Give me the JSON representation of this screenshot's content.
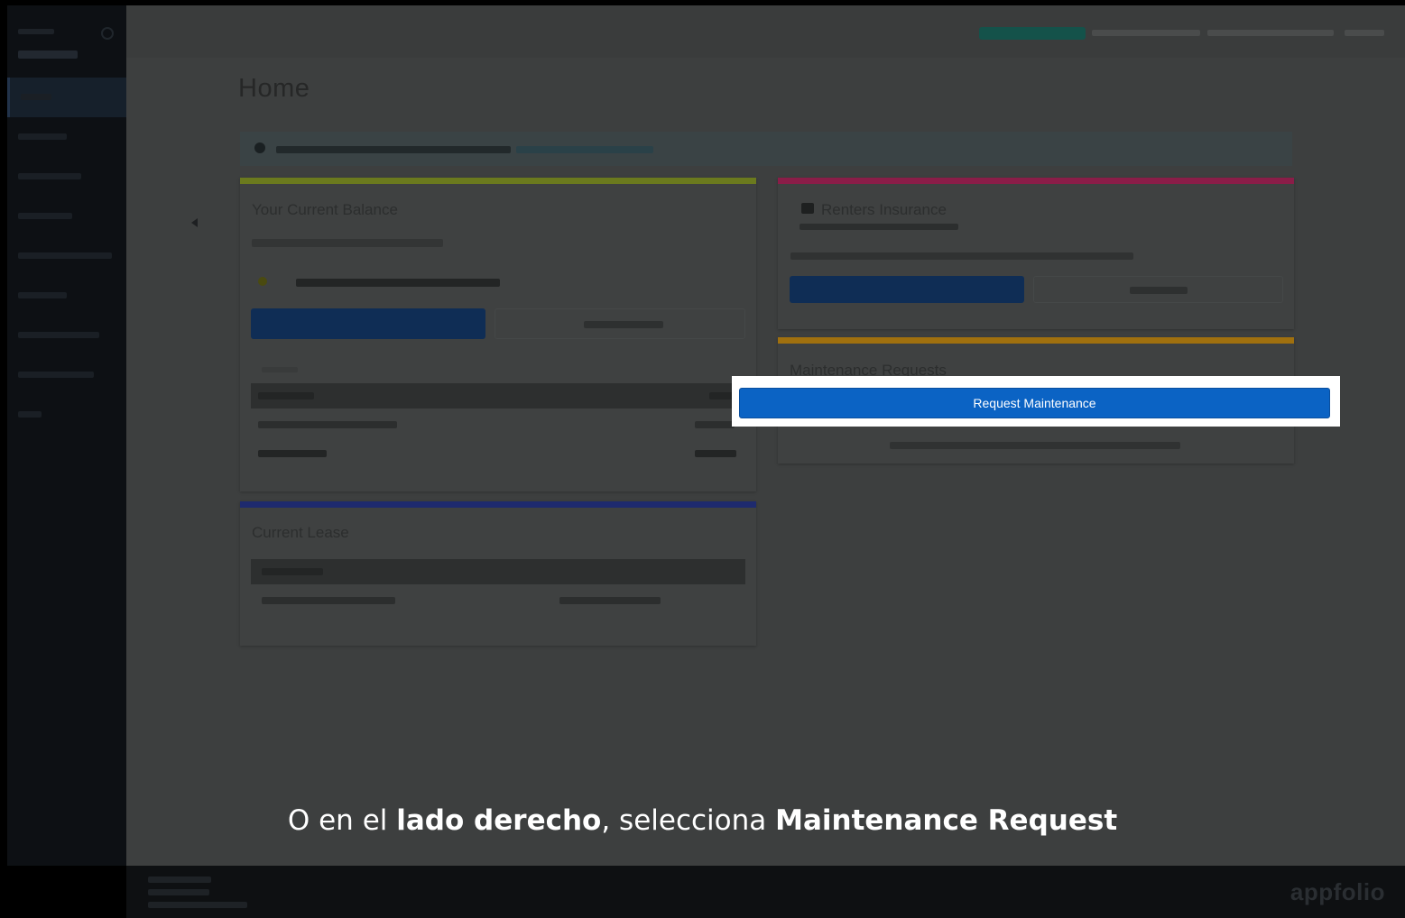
{
  "highlight": {
    "button_label": "Request Maintenance"
  },
  "caption": {
    "part1": "O en el ",
    "bold1": "lado derecho",
    "part2": ", selecciona ",
    "bold2": "Maintenance Request"
  },
  "colors": {
    "accent_blue": "#0b63c4",
    "balance_card_line": "#6b7a1e",
    "insurance_card_line": "#8a1d48",
    "maintenance_card_line": "#a0700e",
    "lease_card_line": "#1e2a6e"
  }
}
